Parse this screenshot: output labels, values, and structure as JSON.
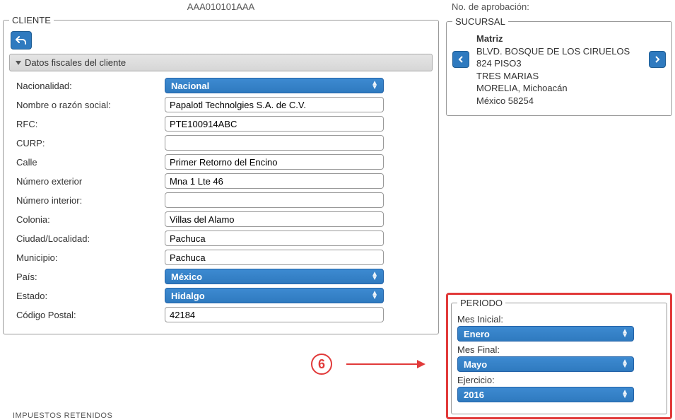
{
  "top_code": "AAA010101AAA",
  "approval_label": "No. de aprobación:",
  "cliente": {
    "legend": "CLIENTE",
    "section_title": "Datos fiscales del cliente",
    "fields": {
      "nacionalidad_label": "Nacionalidad:",
      "nacionalidad_value": "Nacional",
      "razon_label": "Nombre o razón social:",
      "razon_value": "Papalotl Technolgies S.A. de C.V.",
      "rfc_label": "RFC:",
      "rfc_value": "PTE100914ABC",
      "curp_label": "CURP:",
      "curp_value": "",
      "calle_label": "Calle",
      "calle_value": "Primer Retorno del Encino",
      "numext_label": "Número exterior",
      "numext_value": "Mna 1 Lte 46",
      "numint_label": "Número interior:",
      "numint_value": "",
      "colonia_label": "Colonia:",
      "colonia_value": "Villas del Alamo",
      "ciudad_label": "Ciudad/Localidad:",
      "ciudad_value": "Pachuca",
      "municipio_label": "Municipio:",
      "municipio_value": "Pachuca",
      "pais_label": "País:",
      "pais_value": "México",
      "estado_label": "Estado:",
      "estado_value": "Hidalgo",
      "cp_label": "Código Postal:",
      "cp_value": "42184"
    }
  },
  "sucursal": {
    "legend": "SUCURSAL",
    "name": "Matriz",
    "line1": "BLVD. BOSQUE DE LOS CIRUELOS 824 PISO3",
    "line2": "TRES MARIAS",
    "line3": "MORELIA, Michoacán",
    "line4": "México 58254"
  },
  "periodo": {
    "legend": "PERIODO",
    "mes_inicial_label": "Mes Inicial:",
    "mes_inicial_value": "Enero",
    "mes_final_label": "Mes Final:",
    "mes_final_value": "Mayo",
    "ejercicio_label": "Ejercicio:",
    "ejercicio_value": "2016"
  },
  "annotation_number": "6",
  "bottom_cut_text": "IMPUESTOS RETENIDOS"
}
